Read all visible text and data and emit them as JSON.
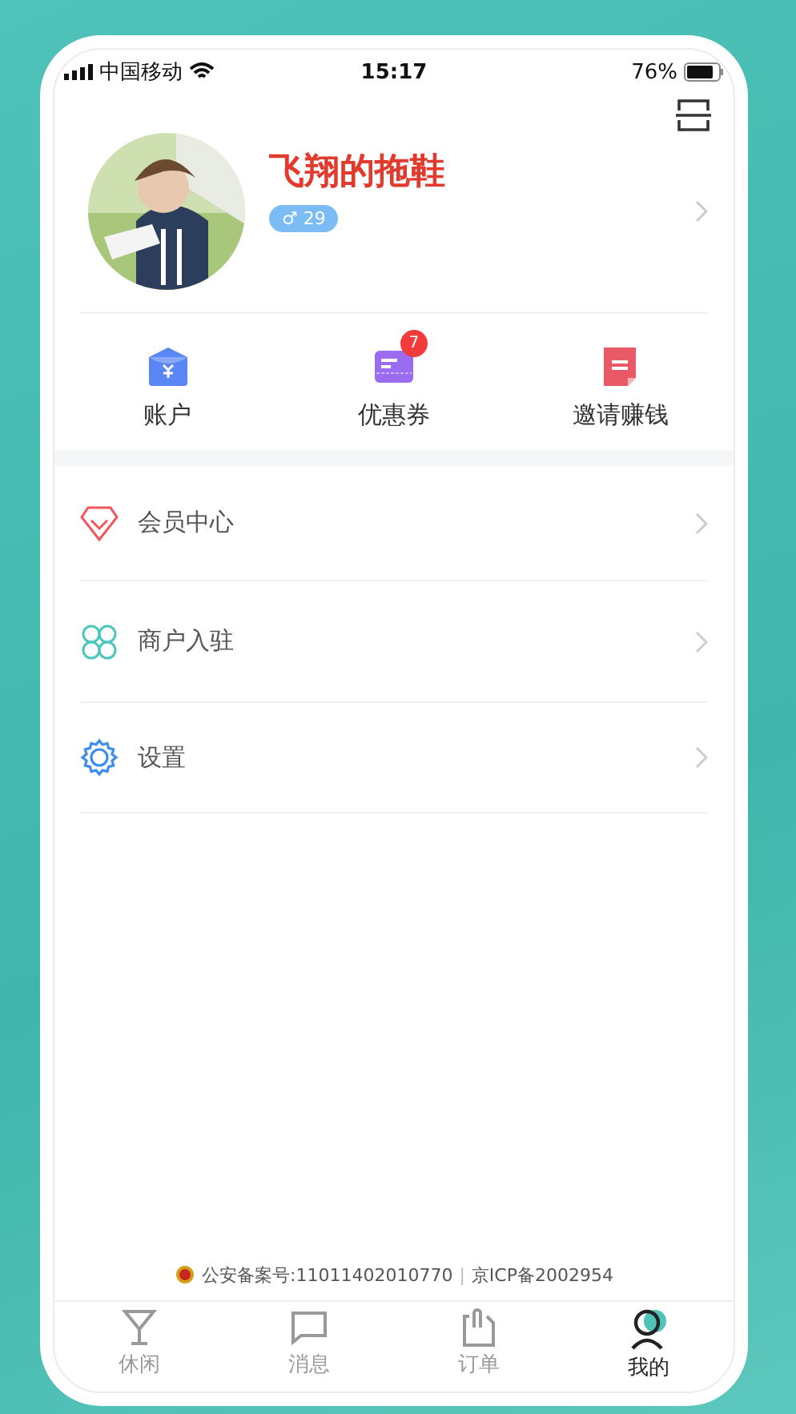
{
  "status_bar": {
    "carrier": "中国移动",
    "time": "15:17",
    "battery": "76%"
  },
  "profile": {
    "name": "飞翔的拖鞋",
    "gender_age": "♂ 29"
  },
  "shortcuts": [
    {
      "kind": "wallet",
      "label": "账户"
    },
    {
      "kind": "coupon",
      "label": "优惠券",
      "badge": "7"
    },
    {
      "kind": "invite",
      "label": "邀请赚钱"
    }
  ],
  "menu": [
    {
      "kind": "diamond",
      "label": "会员中心"
    },
    {
      "kind": "clover",
      "label": "商户入驻"
    },
    {
      "kind": "gear",
      "label": "设置"
    }
  ],
  "footer": {
    "record": "公安备案号:11011402010770",
    "separator": "|",
    "icp": "京ICP备2002954"
  },
  "tabs": [
    {
      "kind": "cup",
      "label": "休闲",
      "selected": false
    },
    {
      "kind": "chat",
      "label": "消息",
      "selected": false
    },
    {
      "kind": "clip",
      "label": "订单",
      "selected": false
    },
    {
      "kind": "user",
      "label": "我的",
      "selected": true
    }
  ]
}
